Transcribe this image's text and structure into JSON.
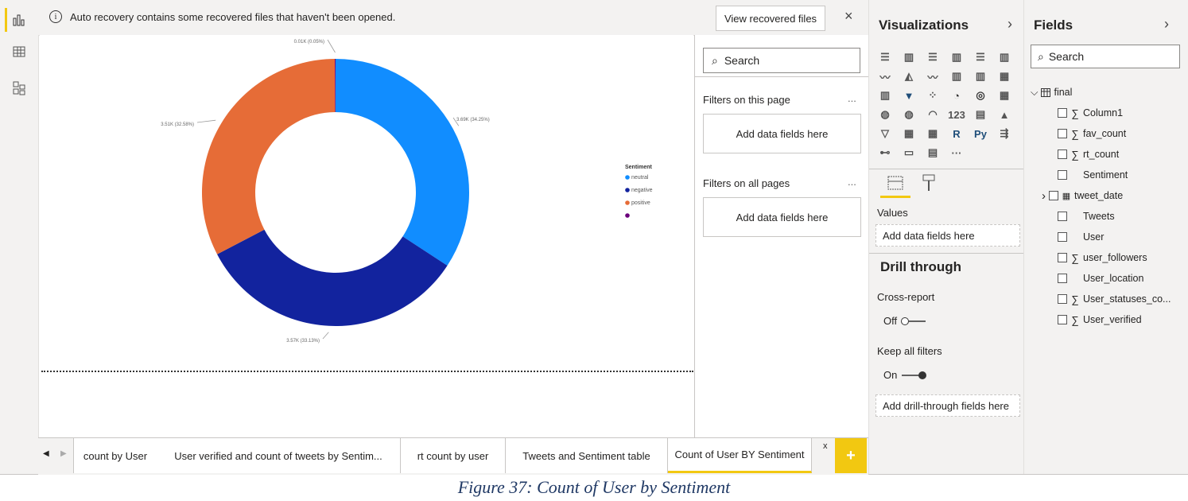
{
  "banner": {
    "message": "Auto recovery contains some recovered files that haven't been opened.",
    "button": "View recovered files",
    "close": "×"
  },
  "chart_data": {
    "type": "donut",
    "legend_title": "Sentiment",
    "legend": [
      "neutral",
      "negative",
      "positive",
      ""
    ],
    "slices": [
      {
        "name": "neutral",
        "value": 3.69,
        "label": "3.69K (34.25%)",
        "color": "#118dff"
      },
      {
        "name": "negative",
        "value": 3.57,
        "label": "3.57K (33.13%)",
        "color": "#12239e"
      },
      {
        "name": "positive",
        "value": 3.51,
        "label": "3.51K (32.58%)",
        "color": "#e66c37"
      },
      {
        "name": "",
        "value": 0.01,
        "label": "0.01K (0.05%)",
        "color": "#6b007b"
      }
    ]
  },
  "filters": {
    "search": "Search",
    "on_page": "Filters on this page",
    "on_all": "Filters on all pages",
    "add": "Add data fields here",
    "more": "..."
  },
  "viz": {
    "title": "Visualizations",
    "values": "Values",
    "add_values": "Add data fields here",
    "drill_title": "Drill through",
    "cross_report": "Cross-report",
    "cross_state": "Off",
    "keep_filters": "Keep all filters",
    "keep_state": "On",
    "add_drill": "Add drill-through fields here",
    "icons": [
      "stacked-bar",
      "stacked-column",
      "clustered-bar",
      "clustered-column",
      "100-bar",
      "100-column",
      "line",
      "area",
      "stacked-area",
      "line-column",
      "line-clustered",
      "ribbon",
      "waterfall",
      "funnel",
      "scatter",
      "pie",
      "donut",
      "treemap",
      "map",
      "filled-map",
      "gauge",
      "card",
      "multirow-card",
      "kpi",
      "slicer",
      "table",
      "matrix",
      "R",
      "Py",
      "key-influencers",
      "decomposition",
      "qa",
      "paginated",
      "more"
    ],
    "icon_glyphs": [
      "☰",
      "▥",
      "☰",
      "▥",
      "☰",
      "▥",
      "〰",
      "◭",
      "〰",
      "▥",
      "▥",
      "▦",
      "▥",
      "▼",
      "⁘",
      "◔",
      "◎",
      "▦",
      "◍",
      "◍",
      "◠",
      "123",
      "▤",
      "▲",
      "▽",
      "▦",
      "▦",
      "R",
      "Py",
      "⇶",
      "⊷",
      "▭",
      "▤",
      "···"
    ]
  },
  "fields": {
    "title": "Fields",
    "search": "Search",
    "table": "final",
    "items": [
      {
        "name": "Column1",
        "sigma": "∑"
      },
      {
        "name": "fav_count",
        "sigma": "∑"
      },
      {
        "name": "rt_count",
        "sigma": "∑"
      },
      {
        "name": "Sentiment",
        "sigma": ""
      },
      {
        "name": "tweet_date",
        "sigma": ""
      },
      {
        "name": "Tweets",
        "sigma": ""
      },
      {
        "name": "User",
        "sigma": ""
      },
      {
        "name": "user_followers",
        "sigma": "∑"
      },
      {
        "name": "User_location",
        "sigma": ""
      },
      {
        "name": "User_statuses_co...",
        "sigma": "∑"
      },
      {
        "name": "User_verified",
        "sigma": "∑"
      }
    ]
  },
  "tabs": [
    "count by User",
    "User verified and count of tweets by Sentim...",
    "rt count by user",
    "Tweets and Sentiment table",
    "Count of User BY Sentiment"
  ],
  "tab_close": "x",
  "tab_add": "+",
  "caption": "Figure 37: Count of User by Sentiment"
}
